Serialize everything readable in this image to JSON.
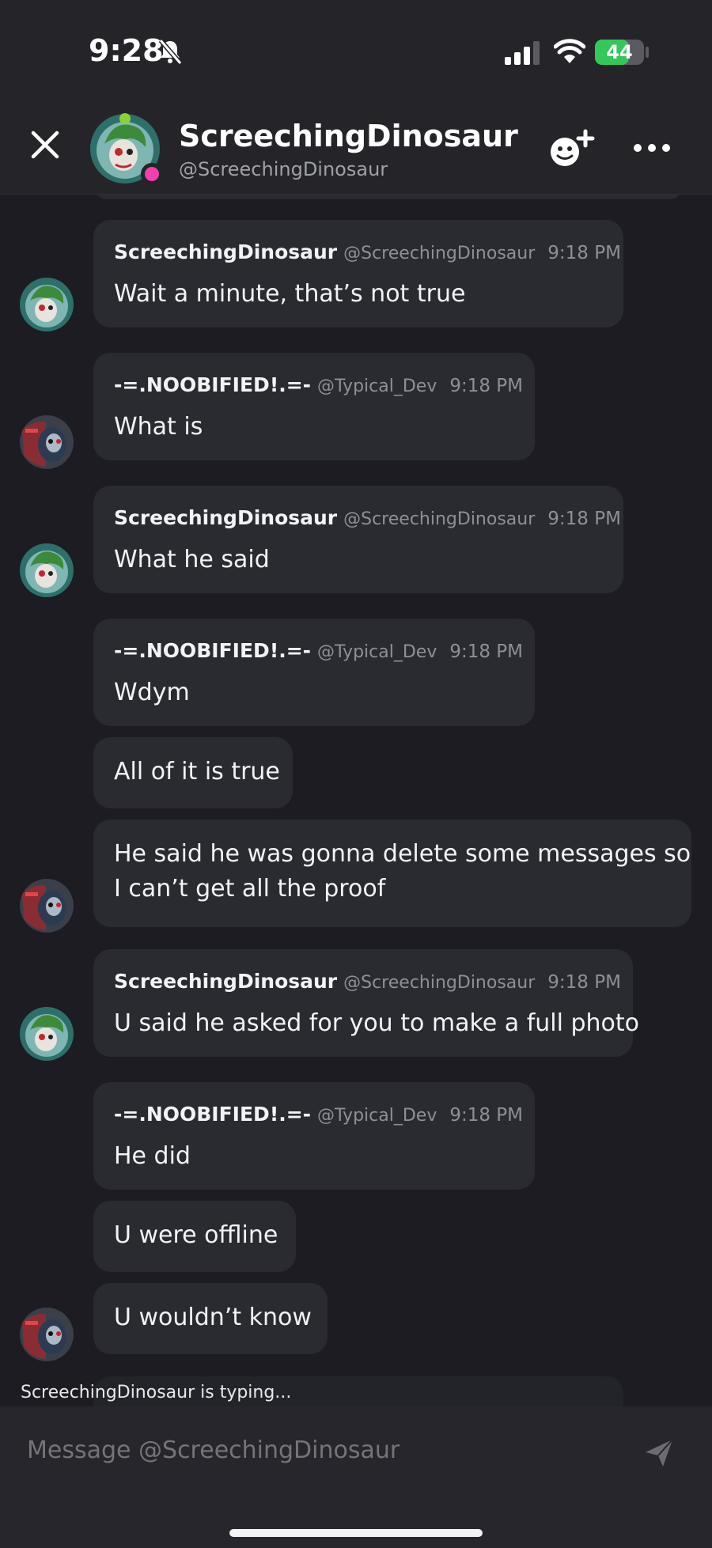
{
  "status_bar": {
    "time": "9:28",
    "battery": "44",
    "battery_level": 0.44
  },
  "header": {
    "name": "ScreechingDinosaur",
    "handle": "@ScreechingDinosaur",
    "status": "online"
  },
  "messages": [
    {
      "author": "ScreechingDinosaur",
      "handle": "@ScreechingDinosaur",
      "time": "9:18 PM",
      "text": "Wait a minute, that’s not true"
    },
    {
      "author": "-=.NOOBIFIED!.=-",
      "handle": "@Typical_Dev",
      "time": "9:18 PM",
      "text": "What is"
    },
    {
      "author": "ScreechingDinosaur",
      "handle": "@ScreechingDinosaur",
      "time": "9:18 PM",
      "text": "What he said"
    },
    {
      "author": "-=.NOOBIFIED!.=-",
      "handle": "@Typical_Dev",
      "time": "9:18 PM",
      "text": "Wdym"
    },
    {
      "text": "All of it is true"
    },
    {
      "text_line1": "He said he was gonna delete some messages so",
      "text_line2": "I can’t get all the proof"
    },
    {
      "author": "ScreechingDinosaur",
      "handle": "@ScreechingDinosaur",
      "time": "9:18 PM",
      "text": "U said he asked for you to make a full photo"
    },
    {
      "author": "-=.NOOBIFIED!.=-",
      "handle": "@Typical_Dev",
      "time": "9:18 PM",
      "text": "He did"
    },
    {
      "text": "U were offline"
    },
    {
      "text": "U wouldn’t know"
    }
  ],
  "typing_indicator": "ScreechingDinosaur is typing...",
  "composer": {
    "placeholder": "Message @ScreechingDinosaur"
  },
  "colors": {
    "background": "#1c1c22",
    "bubble": "#2a2a31",
    "status_online": "#f23fb0",
    "battery": "#34c759"
  }
}
